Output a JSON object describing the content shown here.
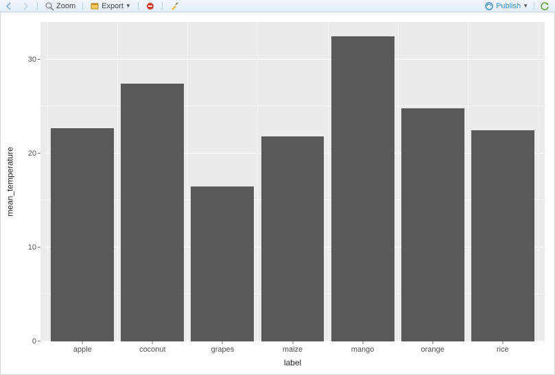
{
  "toolbar": {
    "zoom_label": "Zoom",
    "export_label": "Export",
    "publish_label": "Publish"
  },
  "chart_data": {
    "type": "bar",
    "categories": [
      "apple",
      "coconut",
      "grapes",
      "maize",
      "mango",
      "orange",
      "rice"
    ],
    "values": [
      22.7,
      27.4,
      16.5,
      21.8,
      32.5,
      24.8,
      22.5
    ],
    "xlabel": "label",
    "ylabel": "mean_temperature",
    "ylim": [
      0,
      34
    ],
    "y_ticks": [
      0,
      10,
      20,
      30
    ],
    "title": ""
  }
}
